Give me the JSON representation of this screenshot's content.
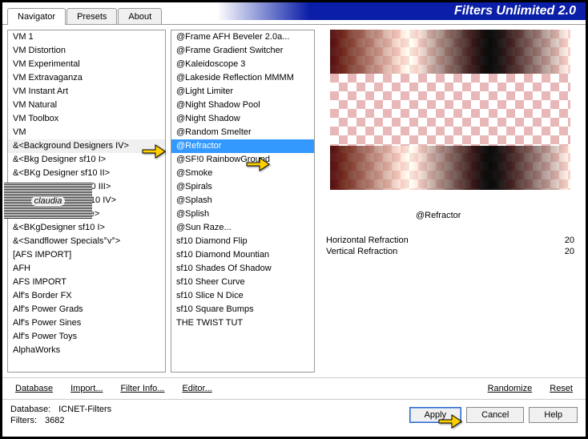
{
  "title": "Filters Unlimited 2.0",
  "tabs": {
    "navigator": "Navigator",
    "presets": "Presets",
    "about": "About"
  },
  "left_list": [
    "VM 1",
    "VM Distortion",
    "VM Experimental",
    "VM Extravaganza",
    "VM Instant Art",
    "VM Natural",
    "VM Toolbox",
    "VM",
    "&<Background Designers IV>",
    "&<Bkg Designer sf10 I>",
    "&<BKg Designer sf10 II>",
    "&<Bkg Designer sf10 III>",
    "&<Bkg Designers sf10 IV>",
    "&<Bkg Kaleidoscope>",
    "&<BKgDesigner sf10 I>",
    "&<Sandflower Specials°v°>",
    "[AFS IMPORT]",
    "AFH",
    "AFS IMPORT",
    "Alf's Border FX",
    "Alf's Power Grads",
    "Alf's Power Sines",
    "Alf's Power Toys",
    "AlphaWorks"
  ],
  "left_selected_index": 8,
  "mid_list": [
    "@Frame AFH Beveler 2.0a...",
    "@Frame Gradient Switcher",
    "@Kaleidoscope 3",
    "@Lakeside Reflection MMMM",
    "@Light Limiter",
    "@Night Shadow Pool",
    "@Night Shadow",
    "@Random Smelter",
    "@Refractor",
    "@SF!0 RainbowGround",
    "@Smoke",
    "@Spirals",
    "@Splash",
    "@Splish",
    "@Sun Raze...",
    "sf10 Diamond Flip",
    "sf10 Diamond Mountian",
    "sf10 Shades Of Shadow",
    "sf10 Sheer Curve",
    "sf10 Slice N Dice",
    "sf10 Square Bumps",
    "THE TWIST TUT"
  ],
  "mid_selected_index": 8,
  "selected_filter": "@Refractor",
  "watermark": "claudia",
  "params": [
    {
      "label": "Horizontal Refraction",
      "value": "20"
    },
    {
      "label": "Vertical Refraction",
      "value": "20"
    }
  ],
  "buttons": {
    "database": "Database",
    "import": "Import...",
    "filter_info": "Filter Info...",
    "editor": "Editor...",
    "randomize": "Randomize",
    "reset": "Reset",
    "apply": "Apply",
    "cancel": "Cancel",
    "help": "Help"
  },
  "footer": {
    "db_label": "Database:",
    "db_value": "ICNET-Filters",
    "filters_label": "Filters:",
    "filters_value": "3682"
  }
}
